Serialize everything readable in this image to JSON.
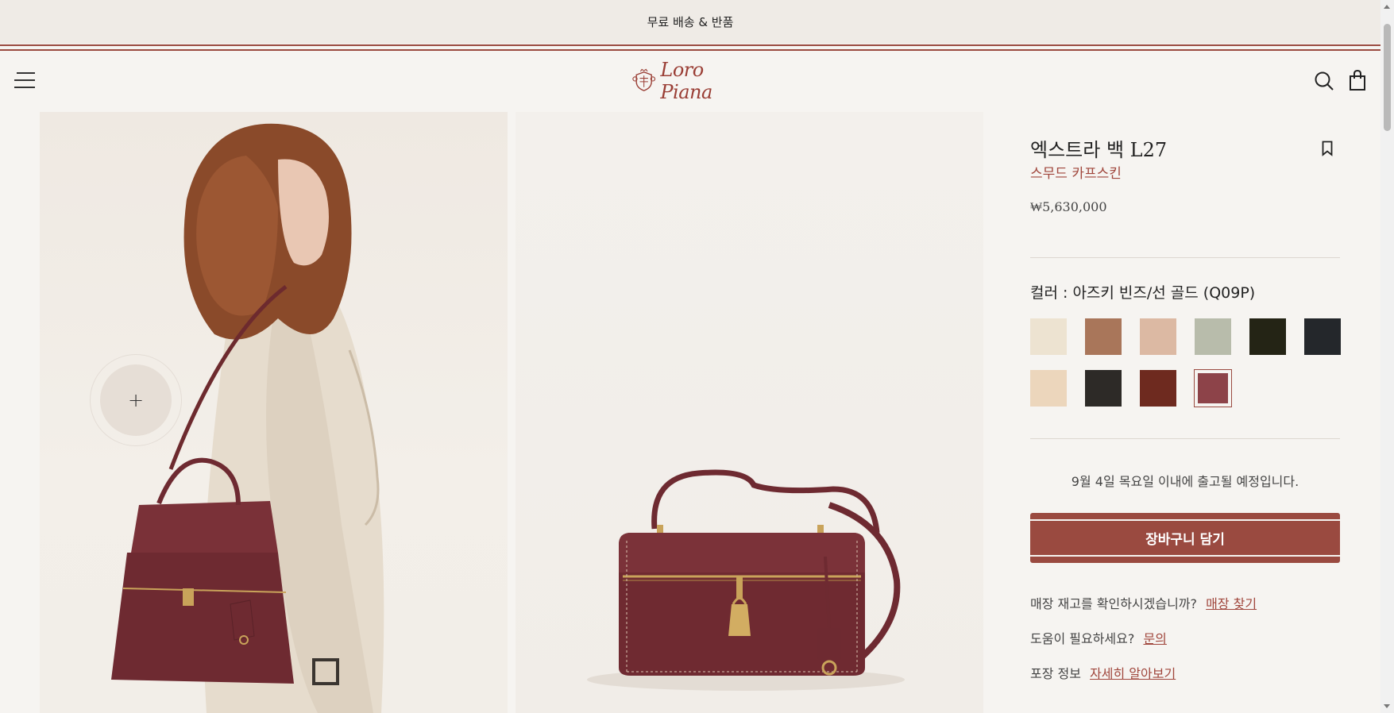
{
  "announcement": "무료 배송 & 반품",
  "brand": "Loro Piana",
  "product": {
    "title": "엑스트라 백 L27",
    "material": "스무드 카프스킨",
    "price": "₩5,630,000",
    "color_label": "컬러 : 아즈키 빈즈/선 골드 (Q09P)",
    "swatches": [
      {
        "color": "#ede3d1"
      },
      {
        "color": "#a9765a"
      },
      {
        "color": "#dcb9a3"
      },
      {
        "color": "#b8bcab"
      },
      {
        "color": "#242415"
      },
      {
        "color": "#24272b"
      },
      {
        "color": "#ecd6bc"
      },
      {
        "color": "#2d2a27"
      },
      {
        "color": "#6e2a1f"
      },
      {
        "color": "#8d4349",
        "selected": true
      }
    ],
    "shipping_note": "9월 4일 목요일 이내에 출고될 예정입니다.",
    "add_to_cart": "장바구니 담기",
    "stock_question": "매장 재고를 확인하시겠습니까?",
    "stock_link": "매장 찾기",
    "help_question": "도움이 필요하세요?",
    "help_link": "문의",
    "packaging_label": "포장 정보",
    "packaging_link": "자세히 알아보기"
  },
  "zoom_symbol": "+",
  "colors": {
    "accent": "#9a4a40",
    "background": "#f6f4f1",
    "topbar": "#efebe6"
  }
}
